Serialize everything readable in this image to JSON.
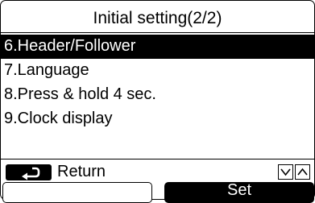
{
  "screen": {
    "title": "Initial setting(2/2)"
  },
  "menu": {
    "items": [
      {
        "label": "6.Header/Follower",
        "selected": true
      },
      {
        "label": "7.Language",
        "selected": false
      },
      {
        "label": "8.Press & hold 4 sec.",
        "selected": false
      },
      {
        "label": "9.Clock display",
        "selected": false
      }
    ]
  },
  "footer": {
    "return_icon": "return-arrow-icon",
    "return_label": "Return",
    "nav_icons": [
      "chevron-down-icon",
      "chevron-up-icon"
    ]
  },
  "softkeys": {
    "left_label": "",
    "right_label": "Set"
  },
  "colors": {
    "foreground": "#000000",
    "background": "#ffffff",
    "highlight": "#000000"
  }
}
